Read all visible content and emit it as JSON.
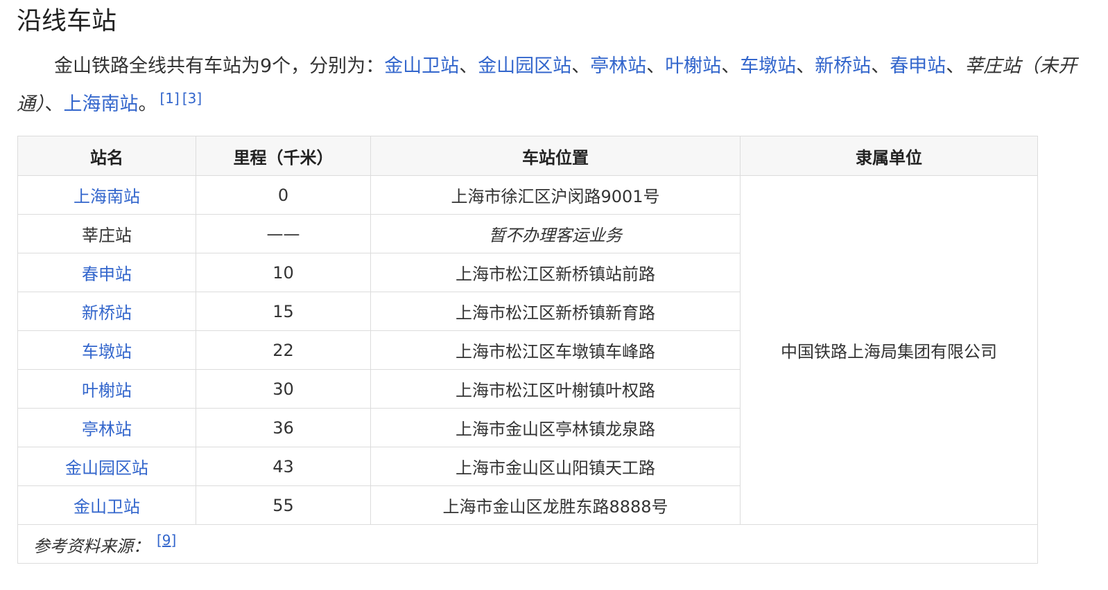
{
  "heading": "沿线车站",
  "intro": {
    "text_before": "金山铁路全线共有车站为9个，分别为：",
    "links": [
      "金山卫站",
      "金山园区站",
      "亭林站",
      "叶榭站",
      "车墩站",
      "新桥站",
      "春申站"
    ],
    "separator": "、",
    "unopened_station": "莘庄站（未开通）",
    "last_link": "上海南站",
    "end": "。",
    "refs": [
      "[1]",
      "[3]"
    ]
  },
  "table": {
    "headers": [
      "站名",
      "里程（千米）",
      "车站位置",
      "隶属单位"
    ],
    "rows": [
      {
        "name": "上海南站",
        "is_link": true,
        "km": "0",
        "location": "上海市徐汇区沪闵路9001号",
        "italic": false
      },
      {
        "name": "莘庄站",
        "is_link": false,
        "km": "——",
        "location": "暂不办理客运业务",
        "italic": true
      },
      {
        "name": "春申站",
        "is_link": true,
        "km": "10",
        "location": "上海市松江区新桥镇站前路",
        "italic": false
      },
      {
        "name": "新桥站",
        "is_link": true,
        "km": "15",
        "location": "上海市松江区新桥镇新育路",
        "italic": false
      },
      {
        "name": "车墩站",
        "is_link": true,
        "km": "22",
        "location": "上海市松江区车墩镇车峰路",
        "italic": false
      },
      {
        "name": "叶榭站",
        "is_link": true,
        "km": "30",
        "location": "上海市松江区叶榭镇叶权路",
        "italic": false
      },
      {
        "name": "亭林站",
        "is_link": true,
        "km": "36",
        "location": "上海市金山区亭林镇龙泉路",
        "italic": false
      },
      {
        "name": "金山园区站",
        "is_link": true,
        "km": "43",
        "location": "上海市金山区山阳镇天工路",
        "italic": false
      },
      {
        "name": "金山卫站",
        "is_link": true,
        "km": "55",
        "location": "上海市金山区龙胜东路8888号",
        "italic": false
      }
    ],
    "owner": "中国铁路上海局集团有限公司",
    "source_label": "参考资料来源：",
    "source_ref": "[9]"
  },
  "colors": {
    "link": "#3366cc",
    "header_bg": "#f7f7f7",
    "border": "#dcdcdc"
  }
}
